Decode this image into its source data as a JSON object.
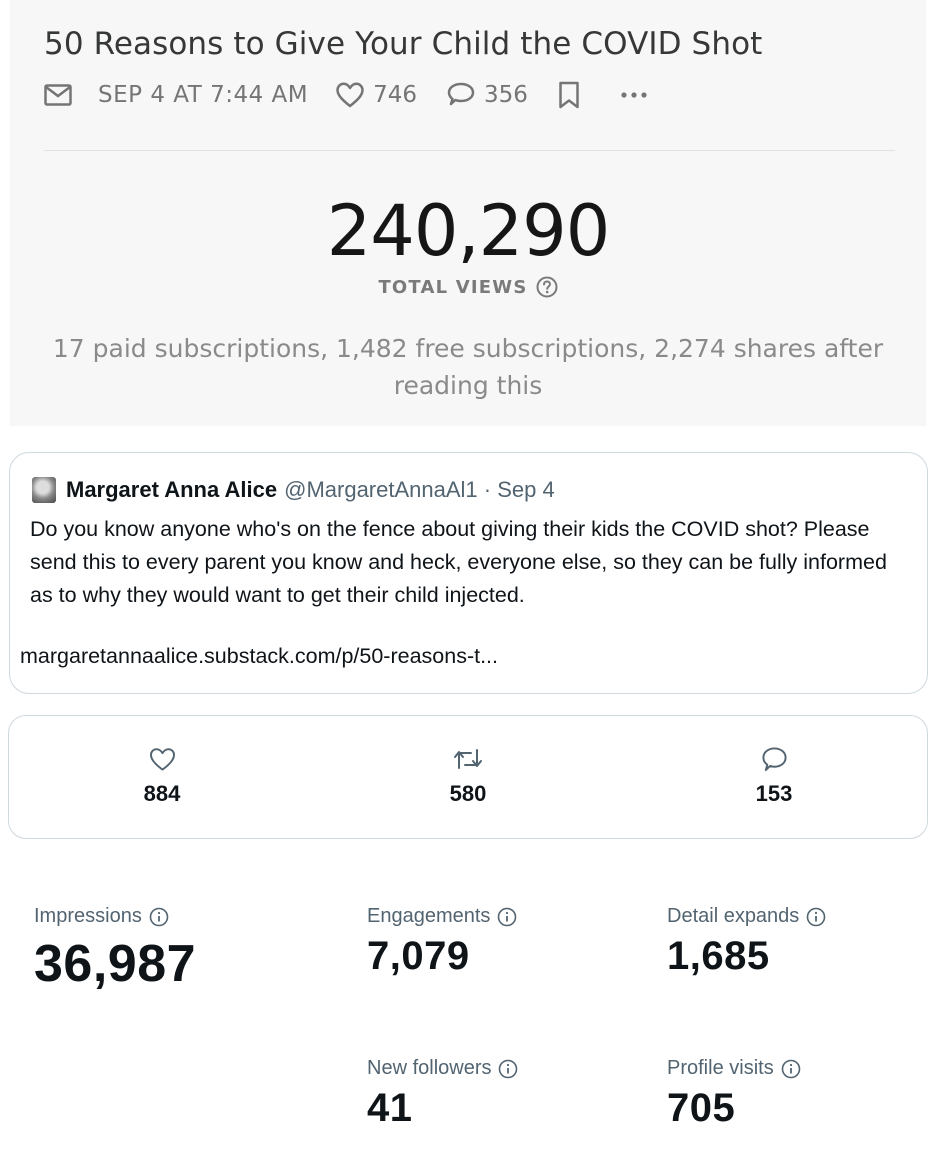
{
  "post": {
    "title": "50 Reasons to Give Your Child the COVID Shot",
    "date": "SEP 4 AT 7:44 AM",
    "likes": "746",
    "comments": "356",
    "total_views": "240,290",
    "total_views_label": "TOTAL VIEWS",
    "subs_line": "17 paid subscriptions, 1,482 free subscriptions, 2,274 shares after reading this"
  },
  "icons": {
    "mail": "mail-icon",
    "heart": "heart-icon",
    "comment": "comment-icon",
    "bookmark": "bookmark-icon",
    "more": "more-icon",
    "help": "question-circle-icon",
    "retweet": "retweet-icon",
    "info": "info-icon"
  },
  "tweet": {
    "author": "Margaret Anna Alice",
    "handle": "@MargaretAnnaAl1 · Sep 4",
    "text": "Do you know anyone who's on the fence about giving their kids the COVID shot? Please send this to every parent you know and heck, everyone else, so they can be fully informed as to why they would want to get their child injected.",
    "link": "margaretannaalice.substack.com/p/50-reasons-t..."
  },
  "engagement": {
    "likes": "884",
    "retweets": "580",
    "replies": "153"
  },
  "metrics": {
    "impressions_label": "Impressions",
    "impressions": "36,987",
    "engagements_label": "Engagements",
    "engagements": "7,079",
    "detail_expands_label": "Detail expands",
    "detail_expands": "1,685",
    "new_followers_label": "New followers",
    "new_followers": "41",
    "profile_visits_label": "Profile visits",
    "profile_visits": "705"
  },
  "colors": {
    "panel_bg": "#f7f7f7",
    "muted_text": "#757575",
    "card_border": "#cfd9de",
    "secondary_text": "#536471"
  }
}
